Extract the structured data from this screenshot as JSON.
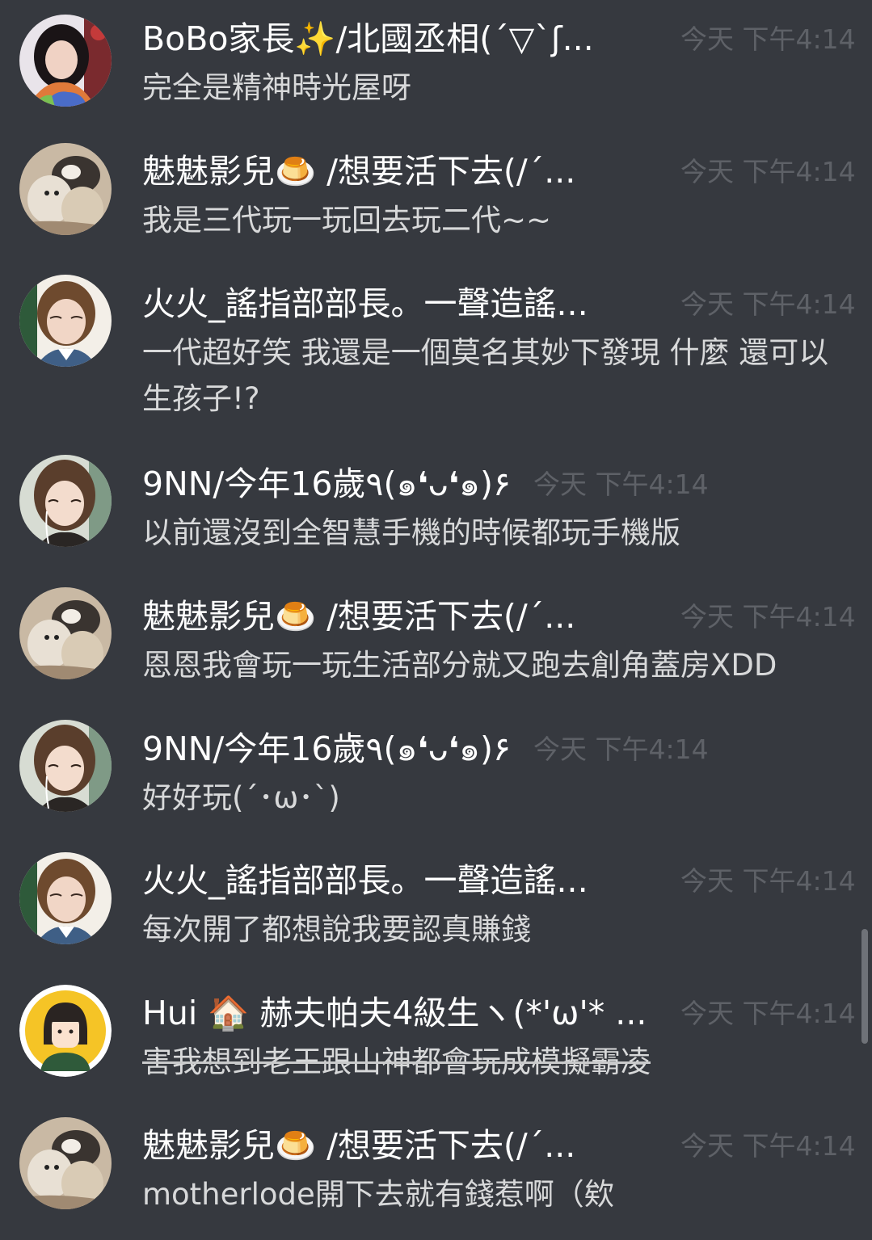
{
  "messages": [
    {
      "name": "BoBo家長✨/北國丞相(´▽`ʃ...",
      "time": "今天 下午4:14",
      "text": "完全是精神時光屋呀",
      "avatar": "woman-red-hair"
    },
    {
      "name": "魅魅影兒🍮 /想要活下去(/´...",
      "time": "今天 下午4:14",
      "text": "我是三代玩一玩回去玩二代~~",
      "avatar": "cats"
    },
    {
      "name": "火火_謠指部部長。一聲造謠...",
      "time": "今天 下午4:14",
      "text": "一代超好笑 我還是一個莫名其妙下發現 什麼 還可以生孩子!?",
      "avatar": "woman-selfie"
    },
    {
      "name": "9NN/今年16歲٩(๑❛ᴗ❛๑)۶",
      "time": "今天 下午4:14",
      "text": "以前還沒到全智慧手機的時候都玩手機版",
      "avatar": "girl-earphones"
    },
    {
      "name": "魅魅影兒🍮 /想要活下去(/´...",
      "time": "今天 下午4:14",
      "text": "恩恩我會玩一玩生活部分就又跑去創角蓋房XDD",
      "avatar": "cats"
    },
    {
      "name": "9NN/今年16歲٩(๑❛ᴗ❛๑)۶",
      "time": "今天 下午4:14",
      "text": "好好玩(´･ω･`)",
      "avatar": "girl-earphones"
    },
    {
      "name": "火火_謠指部部長。一聲造謠...",
      "time": "今天 下午4:14",
      "text": "每次開了都想說我要認真賺錢",
      "avatar": "woman-selfie"
    },
    {
      "name": "Hui 🏠 赫夫帕夫4級生ヽ(*'ω'* ...",
      "time": "今天 下午4:14",
      "text": "害我想到老王跟山神都會玩成模擬霸凌",
      "avatar": "cartoon-girl",
      "strikethrough": true
    },
    {
      "name": "魅魅影兒🍮 /想要活下去(/´...",
      "time": "今天 下午4:14",
      "text": "motherlode開下去就有錢惹啊（欸",
      "avatar": "cats"
    }
  ],
  "colors": {
    "background": "#36393f",
    "name": "#ffffff",
    "text": "#d8d9da",
    "time": "#5e6167"
  }
}
